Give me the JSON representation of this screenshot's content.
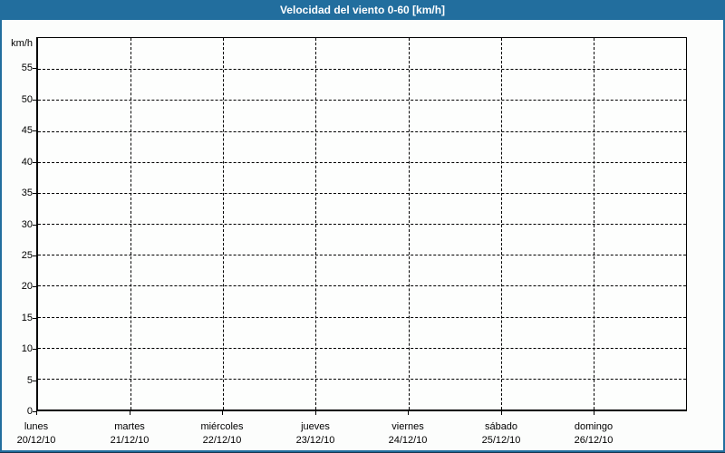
{
  "header": {
    "title": "Velocidad del viento 0-60 [km/h]"
  },
  "colors": {
    "titlebar_blue": "#226e9e",
    "frame_blue": "#226e9e",
    "frame_dark_edge": "#17344f",
    "background": "#fcfdfc",
    "grid_line": "#000000",
    "title_text": "#ffffff"
  },
  "chart_data": {
    "type": "line",
    "title": "Velocidad del viento 0-60 [km/h]",
    "ylabel": "km/h",
    "xlabel": "",
    "ylim": [
      0,
      60
    ],
    "y_ticks": [
      0,
      5,
      10,
      15,
      20,
      25,
      30,
      35,
      40,
      45,
      50,
      55
    ],
    "x_categories": [
      {
        "day": "lunes",
        "date": "20/12/10"
      },
      {
        "day": "martes",
        "date": "21/12/10"
      },
      {
        "day": "miércoles",
        "date": "22/12/10"
      },
      {
        "day": "jueves",
        "date": "23/12/10"
      },
      {
        "day": "viernes",
        "date": "24/12/10"
      },
      {
        "day": "sábado",
        "date": "25/12/10"
      },
      {
        "day": "domingo",
        "date": "26/12/10"
      }
    ],
    "series": [],
    "grid": "dashed",
    "legend": "none"
  }
}
